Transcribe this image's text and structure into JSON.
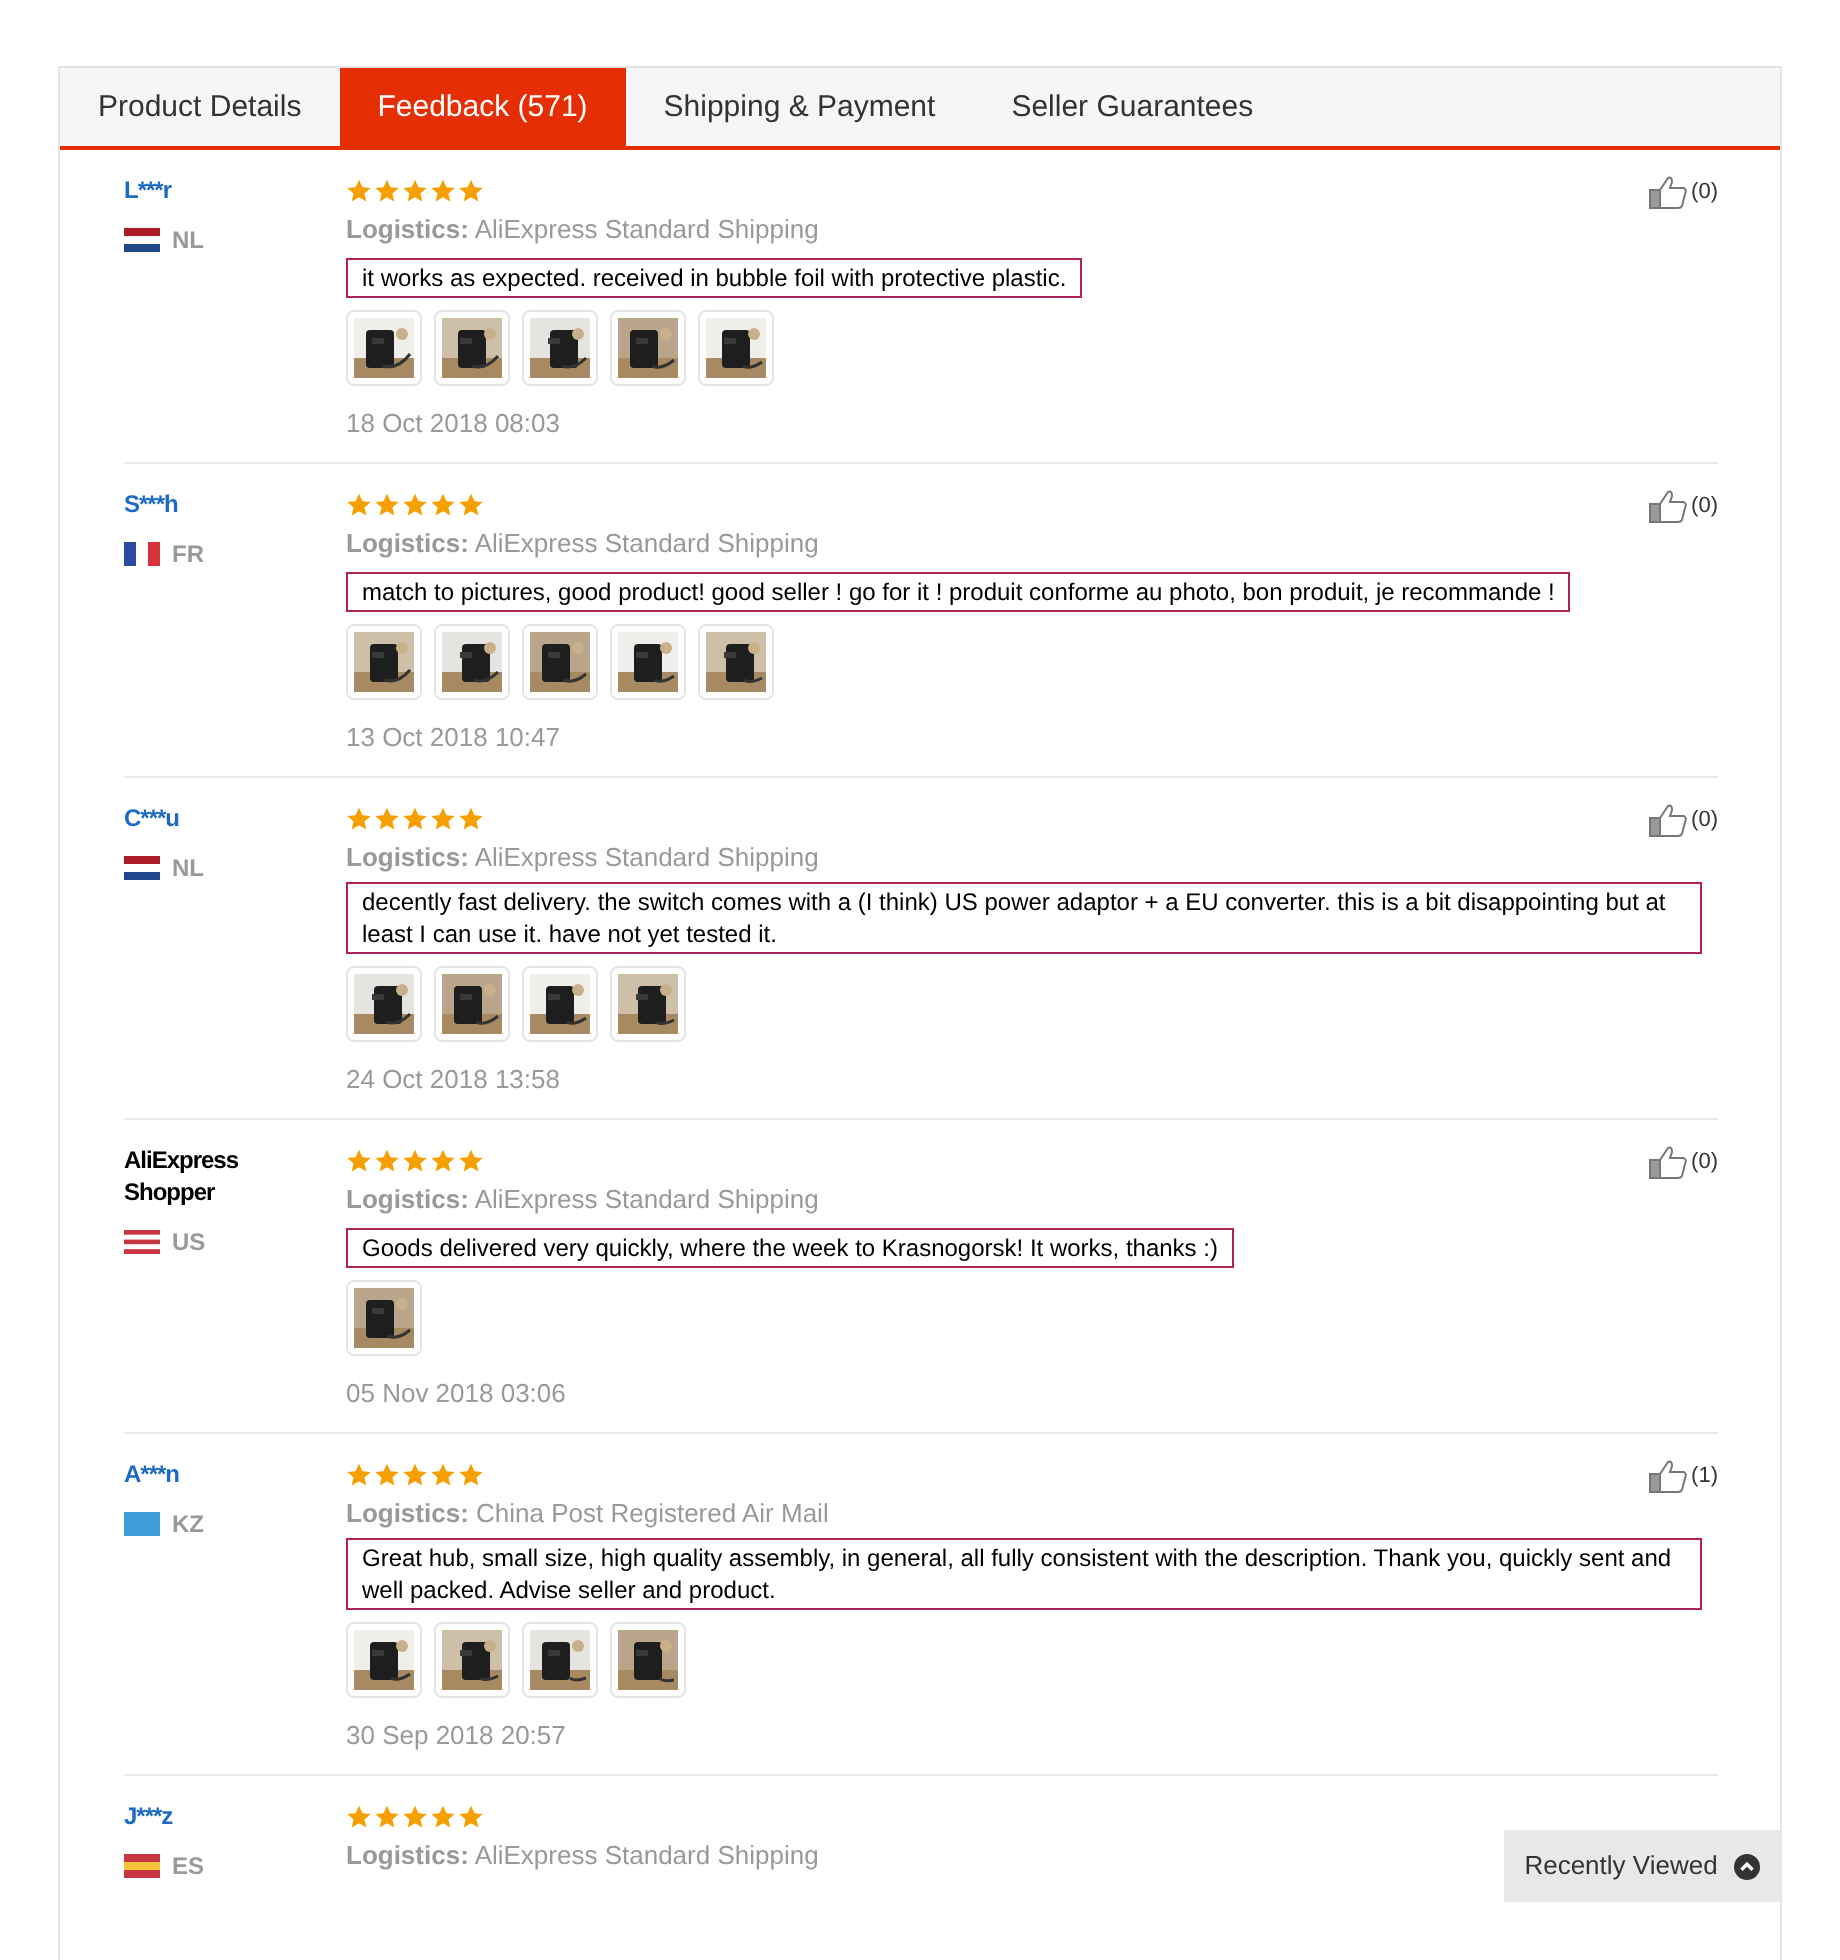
{
  "tabs": [
    {
      "label": "Product Details",
      "selected": false
    },
    {
      "label": "Feedback (571)",
      "selected": true
    },
    {
      "label": "Shipping & Payment",
      "selected": false
    },
    {
      "label": "Seller Guarantees",
      "selected": false
    }
  ],
  "reviews": [
    {
      "name": "L***r",
      "linked": true,
      "country": "NL",
      "stars": 5,
      "logistics_label": "Logistics:",
      "logistics": "AliExpress Standard Shipping",
      "comment": "it works as expected. received in bubble foil with protective plastic.",
      "photos": [
        {
          "kind": "picture"
        },
        {
          "kind": "picture"
        },
        {
          "kind": "picture"
        },
        {
          "kind": "picture"
        },
        {
          "kind": "picture"
        }
      ],
      "date": "18 Oct 2018 08:03",
      "helpful": "(0)"
    },
    {
      "name": "S***h",
      "linked": true,
      "country": "FR",
      "stars": 5,
      "logistics_label": "Logistics:",
      "logistics": "AliExpress Standard Shipping",
      "comment": "match to pictures, good product! good seller ! go for it ! produit conforme au photo, bon produit, je recommande !",
      "photos": [
        {
          "kind": "picture"
        },
        {
          "kind": "picture"
        },
        {
          "kind": "picture"
        },
        {
          "kind": "picture"
        },
        {
          "kind": "picture"
        }
      ],
      "date": "13 Oct 2018 10:47",
      "helpful": "(0)"
    },
    {
      "name": "C***u",
      "linked": true,
      "country": "NL",
      "stars": 5,
      "logistics_label": "Logistics:",
      "logistics": "AliExpress Standard Shipping",
      "comment": "decently fast delivery. the switch comes with a (I think) US power adaptor + a EU converter. this is a bit disappointing but at least I can use it. have not yet tested it.",
      "photos": [
        {
          "kind": "picture"
        },
        {
          "kind": "picture"
        },
        {
          "kind": "picture"
        },
        {
          "kind": "picture"
        }
      ],
      "date": "24 Oct 2018 13:58",
      "helpful": "(0)"
    },
    {
      "name": "AliExpress Shopper",
      "linked": false,
      "country": "US",
      "stars": 5,
      "logistics_label": "Logistics:",
      "logistics": "AliExpress Standard Shipping",
      "comment": "Goods delivered very quickly, where the week to Krasnogorsk! It works, thanks :)",
      "photos": [
        {
          "kind": "picture"
        }
      ],
      "date": "05 Nov 2018 03:06",
      "helpful": "(0)"
    },
    {
      "name": "A***n",
      "linked": true,
      "country": "KZ",
      "stars": 5,
      "logistics_label": "Logistics:",
      "logistics": "China Post Registered Air Mail",
      "comment": "Great hub, small size, high quality assembly, in general, all fully consistent with the description. Thank you, quickly sent and well packed. Advise seller and product.",
      "photos": [
        {
          "kind": "picture"
        },
        {
          "kind": "picture"
        },
        {
          "kind": "picture"
        },
        {
          "kind": "picture"
        }
      ],
      "date": "30 Sep 2018 20:57",
      "helpful": "(1)"
    },
    {
      "name": "J***z",
      "linked": true,
      "country": "ES",
      "stars": 5,
      "logistics_label": "Logistics:",
      "logistics": "AliExpress Standard Shipping"
    }
  ],
  "recently_viewed": "Recently Viewed"
}
